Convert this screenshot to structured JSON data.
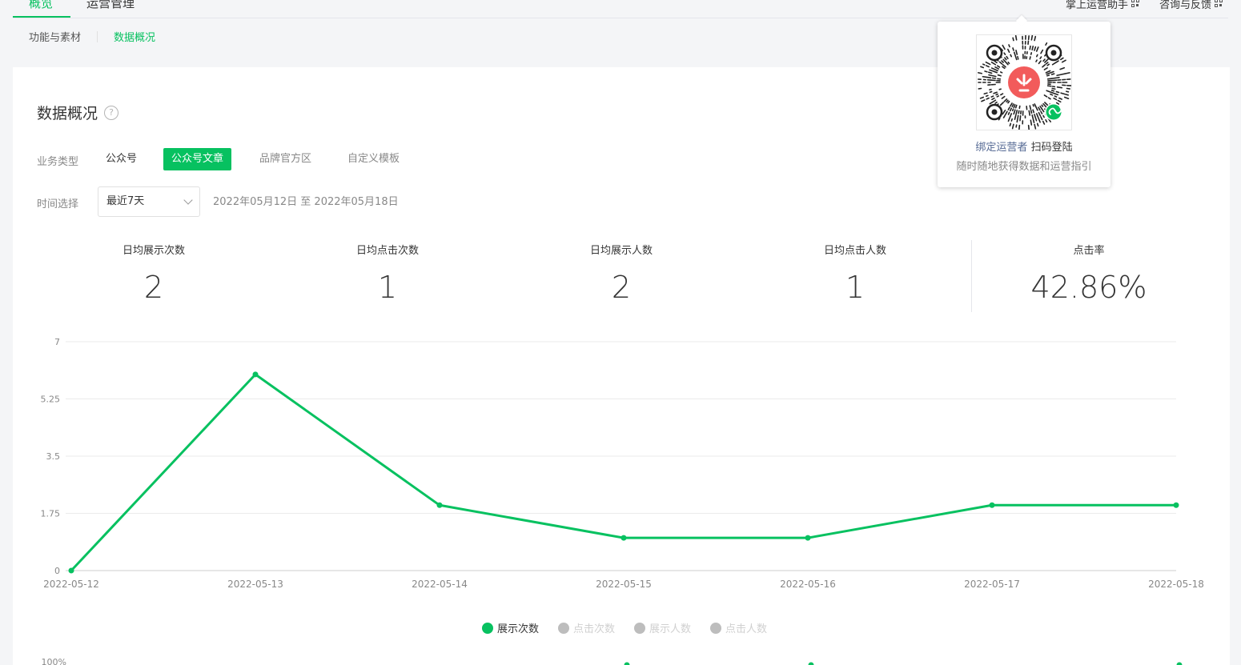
{
  "top_tabs": [
    {
      "label": "概览",
      "active": true
    },
    {
      "label": "运营管理",
      "active": false
    }
  ],
  "top_right": {
    "assistant": "掌上运营助手",
    "feedback": "咨询与反馈"
  },
  "sub_nav": [
    {
      "label": "功能与素材",
      "active": false
    },
    {
      "label": "数据概况",
      "active": true
    }
  ],
  "page": {
    "title": "数据概况",
    "help": "?",
    "biz_type_label": "业务类型",
    "biz_types": [
      {
        "label": "公众号",
        "active": false
      },
      {
        "label": "公众号文章",
        "active": true
      },
      {
        "label": "品牌官方区",
        "active": false
      },
      {
        "label": "自定义模板",
        "active": false
      }
    ],
    "time_label": "时间选择",
    "time_select": "最近7天",
    "date_range": "2022年05月12日 至 2022年05月18日"
  },
  "stats": [
    {
      "label": "日均展示次数",
      "value": "2"
    },
    {
      "label": "日均点击次数",
      "value": "1"
    },
    {
      "label": "日均展示人数",
      "value": "2"
    },
    {
      "label": "日均点击人数",
      "value": "1"
    },
    {
      "label": "点击率",
      "value": "42.86%"
    }
  ],
  "colors": {
    "accent": "#07c160",
    "inactive_legend": "#bdbdbd",
    "link_blue": "#576b95"
  },
  "popover": {
    "line1_a": "绑定运营者",
    "line1_b": "扫码登陆",
    "line2": "随时随地获得数据和运营指引",
    "icon": "mini-program-qr-code"
  },
  "chart_data": [
    {
      "type": "line",
      "x": [
        "2022-05-12",
        "2022-05-13",
        "2022-05-14",
        "2022-05-15",
        "2022-05-16",
        "2022-05-17",
        "2022-05-18"
      ],
      "yticks": [
        "0",
        "1.75",
        "3.5",
        "5.25",
        "7"
      ],
      "ylim": [
        0,
        7
      ],
      "grid": true,
      "legend_placement": "bottom",
      "series": [
        {
          "name": "展示次数",
          "values": [
            0,
            6,
            2,
            1,
            1,
            2,
            2
          ],
          "visible": true
        },
        {
          "name": "点击次数",
          "visible": false
        },
        {
          "name": "展示人数",
          "visible": false
        },
        {
          "name": "点击人数",
          "visible": false
        }
      ]
    },
    {
      "type": "line",
      "yticks_visible": [
        "100%"
      ],
      "partial": true
    }
  ]
}
